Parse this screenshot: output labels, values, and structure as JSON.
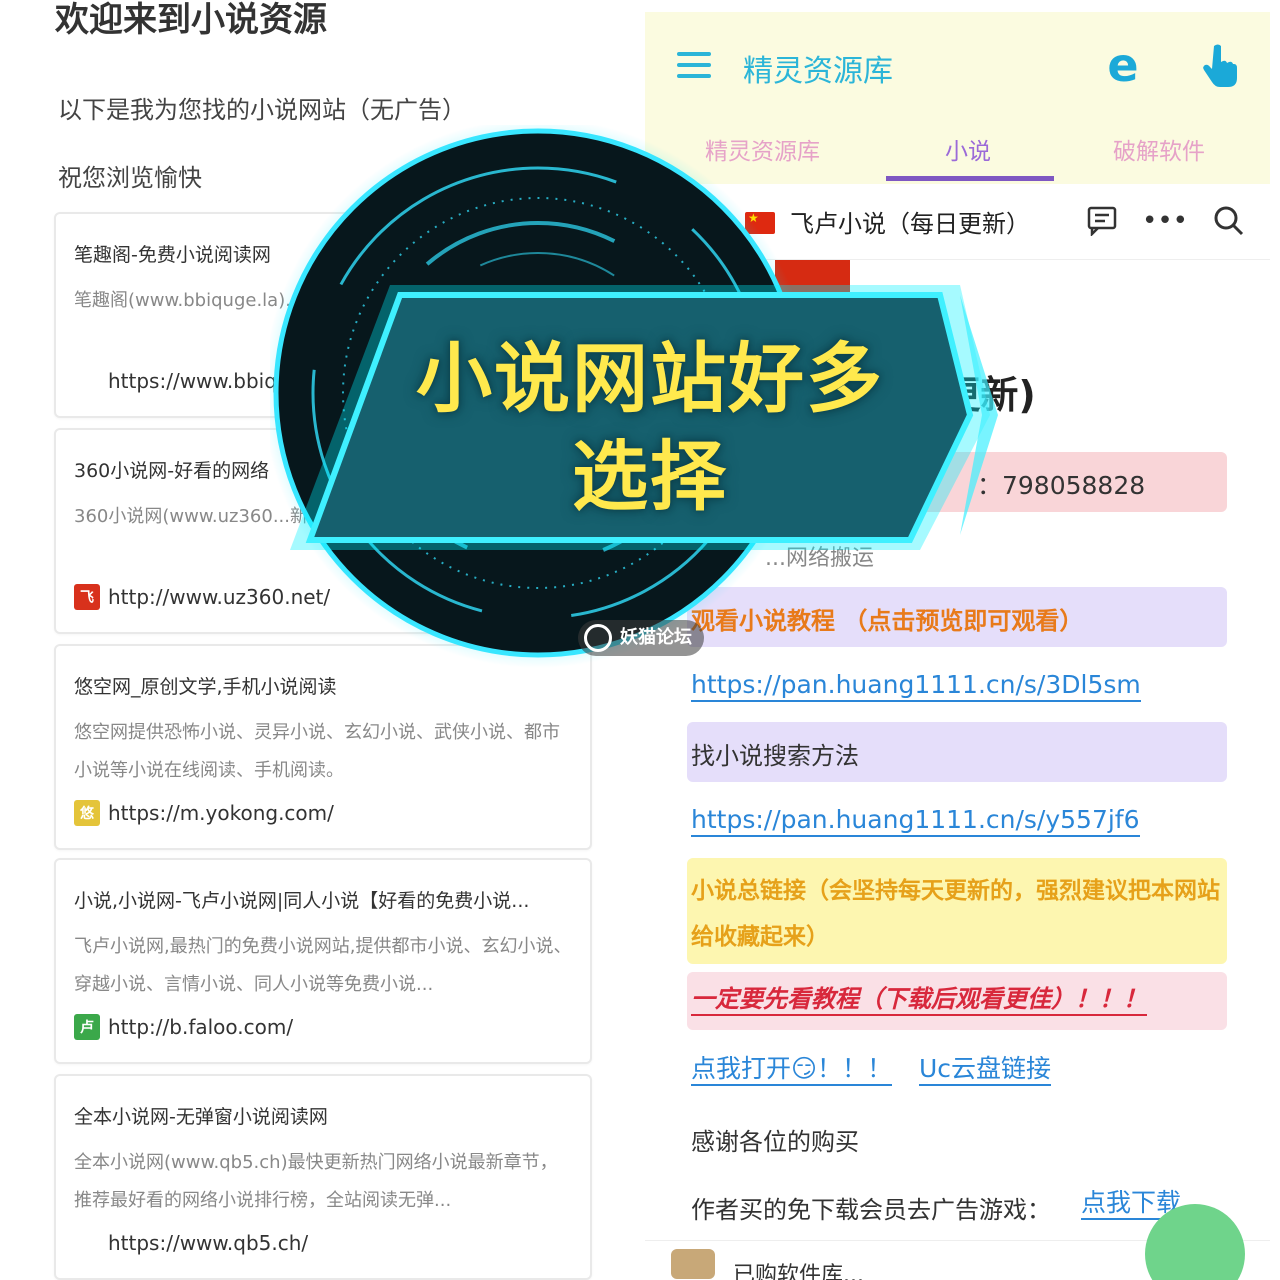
{
  "left": {
    "title": "欢迎来到小说资源",
    "intro": "以下是我为您找的小说网站（无广告）",
    "greeting": "祝您浏览愉快",
    "cards": [
      {
        "title": "笔趣阁-免费小说阅读网",
        "desc": "笔趣阁(www.bbiquge.la)...阅读服务，全站小说免...",
        "url": "https://www.bbiq",
        "icon": ""
      },
      {
        "title": "360小说网-好看的网络",
        "desc": "360小说网(www.uz360...新章节，推荐最好看的网络...",
        "url": "http://www.uz360.net/",
        "icon": "飞"
      },
      {
        "title": "悠空网_原创文学,手机小说阅读",
        "desc": "悠空网提供恐怖小说、灵异小说、玄幻小说、武侠小说、都市小说等小说在线阅读、手机阅读。",
        "url": "https://m.yokong.com/",
        "icon": "悠"
      },
      {
        "title": "小说,小说网-飞卢小说网|同人小说【好看的免费小说...",
        "desc": "飞卢小说网,最热门的免费小说网站,提供都市小说、玄幻小说、穿越小说、言情小说、同人小说等免费小说...",
        "url": "http://b.faloo.com/",
        "icon": "卢"
      },
      {
        "title": "全本小说网-无弹窗小说阅读网",
        "desc": "全本小说网(www.qb5.ch)最快更新热门网络小说最新章节，推荐最好看的网络小说排行榜，全站阅读无弹...",
        "url": "https://www.qb5.ch/",
        "icon": ""
      }
    ]
  },
  "right": {
    "app_title": "精灵资源库",
    "tabs": [
      "精灵资源库",
      "小说",
      "破解软件"
    ],
    "active_tab": "小说",
    "doc_title": "飞卢小说（每日更新）",
    "big_heading": "]更新)",
    "red_block_text": "：798058828",
    "faint_line": "...网络搬运",
    "tutorial_label": "观看小说教程 （点击预览即可观看）",
    "link1": "https://pan.huang1111.cn/s/3Dl5sm",
    "search_label": "找小说搜索方法",
    "link2": "https://pan.huang1111.cn/s/y557jf6",
    "yellow_note": "小说总链接（会坚持每天更新的，强烈建议把本网站给收藏起来）",
    "warning": "一定要先看教程（下载后观看更佳）！！！",
    "open_link": "点我打开😏！！！",
    "uc_link": "Uc云盘链接",
    "thanks": "感谢各位的购买",
    "game_prefix": "作者买的免下载会员去广告游戏：",
    "game_link": "点我下载",
    "bottom_text": "已购软件库..."
  },
  "overlay": {
    "banner": "小说网站好多选择",
    "watermark": "妖猫论坛"
  },
  "colors": {
    "accent_cyan": "#2bb5d8",
    "tab_active": "#7e57c2",
    "banner_text": "#ffe94d",
    "banner_fill": "#16606e"
  },
  "icons": [
    "menu-icon",
    "edge-browser-icon",
    "pointer-icon",
    "flag-icon",
    "comment-icon",
    "more-icon",
    "search-icon"
  ]
}
